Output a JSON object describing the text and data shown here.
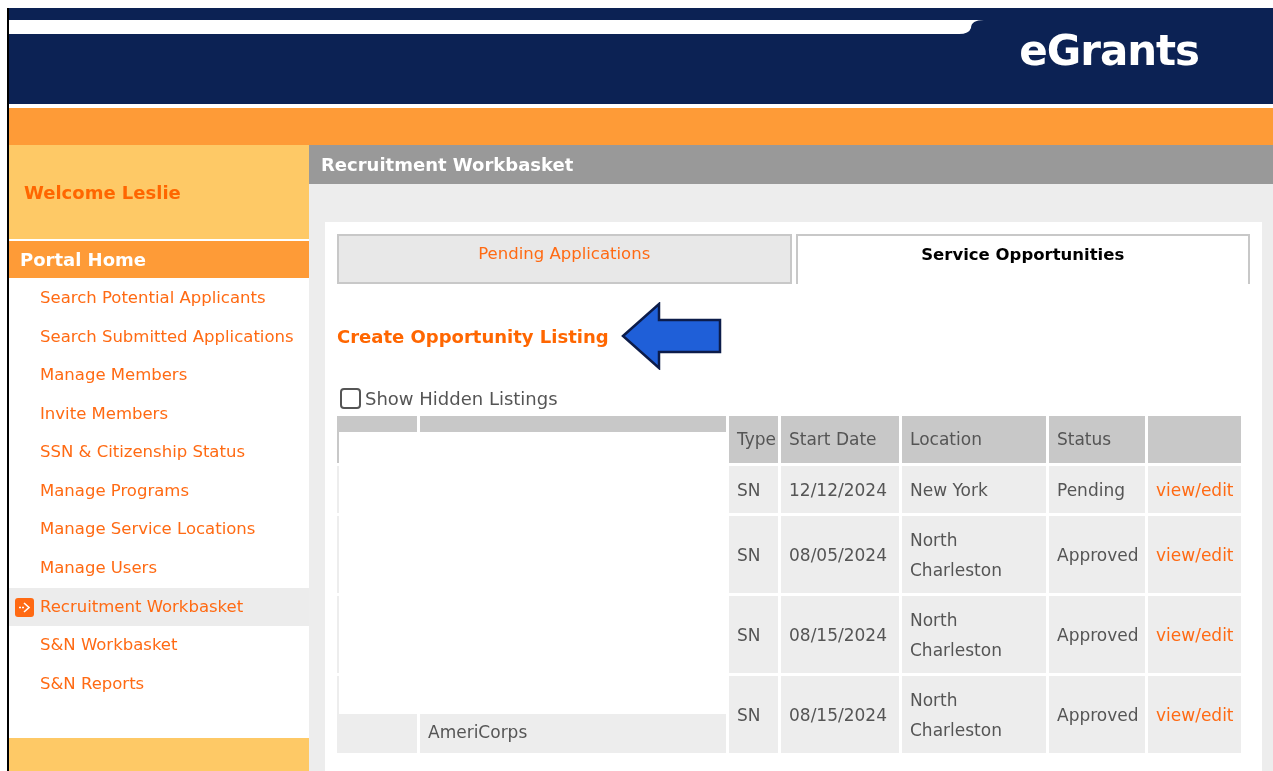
{
  "header": {
    "logo": "eGrants"
  },
  "sidebar": {
    "welcome": "Welcome Leslie",
    "section": "Portal Home",
    "items": [
      {
        "label": "Search Potential Applicants",
        "selected": false
      },
      {
        "label": "Search Submitted Applications",
        "selected": false
      },
      {
        "label": "Manage Members",
        "selected": false
      },
      {
        "label": "Invite Members",
        "selected": false
      },
      {
        "label": "SSN & Citizenship Status",
        "selected": false
      },
      {
        "label": "Manage Programs",
        "selected": false
      },
      {
        "label": "Manage Service Locations",
        "selected": false
      },
      {
        "label": "Manage Users",
        "selected": false
      },
      {
        "label": "Recruitment Workbasket",
        "selected": true
      },
      {
        "label": "S&N Workbasket",
        "selected": false
      },
      {
        "label": "S&N Reports",
        "selected": false
      }
    ]
  },
  "page_title": "Recruitment Workbasket",
  "tabs": [
    {
      "label": "Pending Applications",
      "selected": false
    },
    {
      "label": "Service Opportunities",
      "selected": true
    }
  ],
  "create_link": "Create Opportunity Listing",
  "show_hidden": {
    "label": "Show Hidden Listings",
    "checked": false
  },
  "table": {
    "columns": [
      "Type",
      "Start Date",
      "Location",
      "Status"
    ],
    "rows": [
      {
        "type": "SN",
        "start_date": "12/12/2024",
        "location": "New York",
        "status": "Pending",
        "view": "view",
        "separator": "/",
        "edit": "edit"
      },
      {
        "type": "SN",
        "start_date": "08/05/2024",
        "location": "North Charleston",
        "status": "Approved",
        "view": "view",
        "separator": "/",
        "edit": "edit"
      },
      {
        "type": "SN",
        "start_date": "08/15/2024",
        "location": "North Charleston",
        "status": "Approved",
        "view": "view",
        "separator": "/",
        "edit": "edit"
      },
      {
        "program": "AmeriCorps",
        "type": "SN",
        "start_date": "08/15/2024",
        "location": "North Charleston",
        "status": "Approved",
        "view": "view",
        "separator": "/",
        "edit": "edit"
      }
    ]
  }
}
